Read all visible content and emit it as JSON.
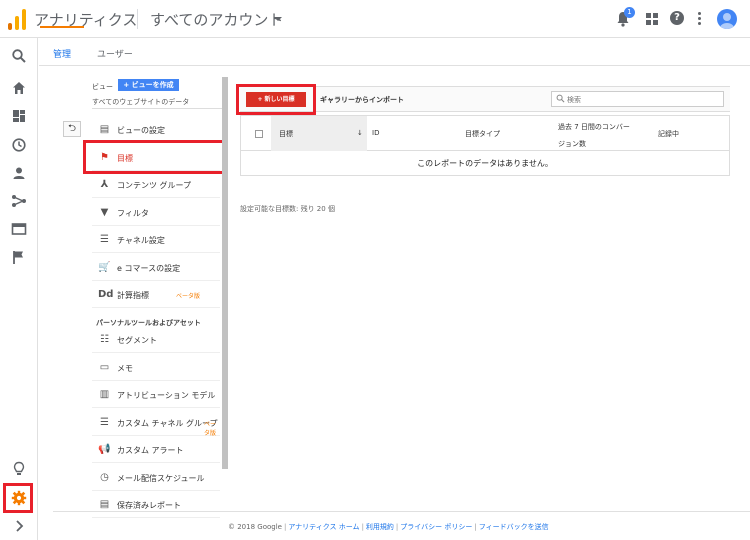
{
  "header": {
    "app_title": "アナリティクス",
    "account_label": "すべてのアカウント",
    "notification_count": "1",
    "help_glyph": "?"
  },
  "tabs": [
    {
      "label": "管理"
    },
    {
      "label": "ユーザー"
    }
  ],
  "view": {
    "label": "ビュー",
    "create_button": "+ ビューを作成",
    "selected_view": "すべてのウェブサイトのデータ",
    "back_glyph": "⮌"
  },
  "nav_items": [
    {
      "label": "ビューの設定",
      "icon": "document-icon"
    },
    {
      "label": "目標",
      "icon": "flag-icon",
      "active": true
    },
    {
      "label": "コンテンツ グループ",
      "icon": "person-walk-icon"
    },
    {
      "label": "フィルタ",
      "icon": "filter-icon"
    },
    {
      "label": "チャネル設定",
      "icon": "channel-icon"
    },
    {
      "label": "e コマースの設定",
      "icon": "cart-icon"
    },
    {
      "label": "計算指標",
      "icon": "dd-icon",
      "beta": "ベータ版"
    }
  ],
  "personal_header": "パーソナルツールおよびアセット",
  "personal_items": [
    {
      "label": "セグメント",
      "icon": "segment-icon"
    },
    {
      "label": "メモ",
      "icon": "note-icon"
    },
    {
      "label": "アトリビューション モデル",
      "icon": "bar-chart-icon"
    },
    {
      "label": "カスタム チャネル グループ",
      "icon": "channel-group-icon",
      "beta": "ベータ版"
    },
    {
      "label": "カスタム アラート",
      "icon": "megaphone-icon"
    },
    {
      "label": "メール配信スケジュール",
      "icon": "clock-icon"
    },
    {
      "label": "保存済みレポート",
      "icon": "document-icon"
    }
  ],
  "goals": {
    "new_button": "+ 新しい目標",
    "import_link": "ギャラリーからインポート",
    "search_placeholder": "検索",
    "columns": [
      "目標",
      "ID",
      "目標タイプ",
      "過去 7 日間のコンバージョン数",
      "記録中"
    ],
    "sort_glyph": "↓",
    "empty_message": "このレポートのデータはありません。",
    "limit_note": "設定可能な目標数: 残り 20 個"
  },
  "footer": {
    "copyright": "© 2018 Google",
    "links": [
      "アナリティクス ホーム",
      "利用規約",
      "プライバシー ポリシー",
      "フィードバックを送信"
    ]
  },
  "colors": {
    "accent_blue": "#1a73e8",
    "highlight_red": "#e8202a",
    "logo_orange": "#f9ab00",
    "logo_dark_orange": "#e37400"
  }
}
